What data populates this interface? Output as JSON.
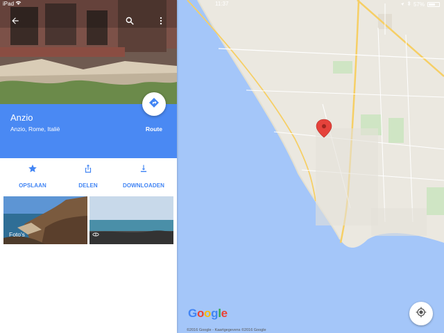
{
  "status_bar": {
    "carrier": "iPad",
    "time": "11:37",
    "battery": "57%"
  },
  "place": {
    "name": "Anzio",
    "address": "Anzio, Rome, Italië",
    "route_label": "Route"
  },
  "actions": [
    {
      "label": "OPSLAAN",
      "icon": "star-icon"
    },
    {
      "label": "DELEN",
      "icon": "share-icon"
    },
    {
      "label": "DOWNLOADEN",
      "icon": "download-icon"
    }
  ],
  "photos": {
    "first_label": "Foto's"
  },
  "map": {
    "attribution": "©2016 Google - Kaartgegevens ©2016 Google",
    "logo_letters": [
      {
        "ch": "G",
        "color": "#4285f4"
      },
      {
        "ch": "o",
        "color": "#ea4335"
      },
      {
        "ch": "o",
        "color": "#fbbc05"
      },
      {
        "ch": "g",
        "color": "#4285f4"
      },
      {
        "ch": "l",
        "color": "#34a853"
      },
      {
        "ch": "e",
        "color": "#ea4335"
      }
    ],
    "sea_color": "#a4c6f9",
    "land_color": "#ebe8e0",
    "accent_color": "#4a89f3"
  }
}
